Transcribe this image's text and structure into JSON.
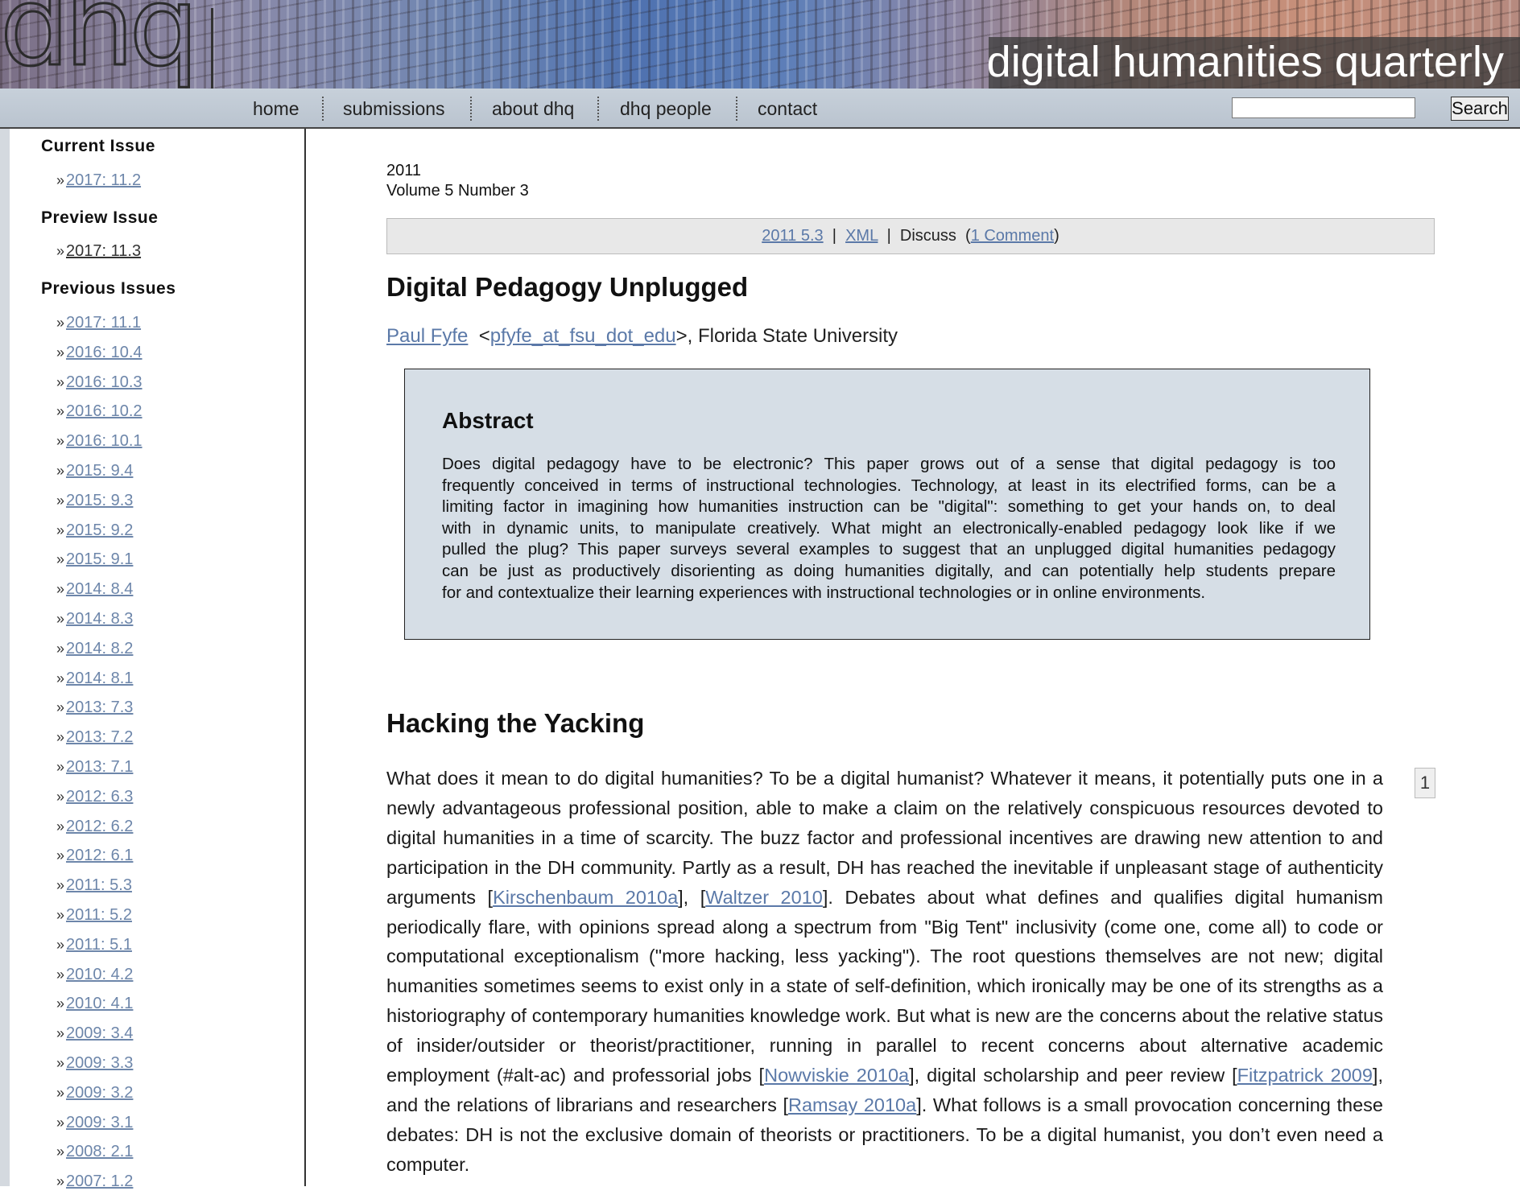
{
  "header": {
    "logo_text": "dhq",
    "site_title": "digital humanities quarterly"
  },
  "nav": {
    "items": [
      "home",
      "submissions",
      "about dhq",
      "dhq people",
      "contact"
    ],
    "search_button": "Search",
    "search_value": ""
  },
  "sidebar": {
    "current_heading": "Current Issue",
    "current": [
      "2017: 11.2"
    ],
    "preview_heading": "Preview Issue",
    "preview": [
      "2017: 11.3"
    ],
    "previous_heading": "Previous Issues",
    "previous": [
      "2017: 11.1",
      "2016: 10.4",
      "2016: 10.3",
      "2016: 10.2",
      "2016: 10.1",
      "2015: 9.4",
      "2015: 9.3",
      "2015: 9.2",
      "2015: 9.1",
      "2014: 8.4",
      "2014: 8.3",
      "2014: 8.2",
      "2014: 8.1",
      "2013: 7.3",
      "2013: 7.2",
      "2013: 7.1",
      "2012: 6.3",
      "2012: 6.2",
      "2012: 6.1",
      "2011: 5.3",
      "2011: 5.2",
      "2011: 5.1",
      "2010: 4.2",
      "2010: 4.1",
      "2009: 3.4",
      "2009: 3.3",
      "2009: 3.2",
      "2009: 3.1",
      "2008: 2.1",
      "2007: 1.2"
    ]
  },
  "issue": {
    "year": "2011",
    "volume": "Volume 5 Number 3",
    "issue_link": "2011 5.3",
    "xml_link": "XML",
    "discuss_label": "Discuss",
    "comments_link": "1 Comment"
  },
  "article": {
    "title": "Digital Pedagogy Unplugged",
    "author": "Paul Fyfe",
    "email": "pfyfe_at_fsu_dot_edu",
    "affiliation": "Florida State University",
    "abstract_heading": "Abstract",
    "abstract_lines": [
      "Does digital pedagogy have to be electronic? This paper grows out of a sense that digital pedagogy is too",
      "frequently conceived in terms of instructional technologies. Technology, at least in its electrified forms, can be a",
      "limiting factor in imagining how humanities instruction can be \"digital\": something to get your hands on, to deal",
      "with in dynamic units, to manipulate creatively. What might an electronically-enabled pedagogy look like if we",
      "pulled the plug? This paper surveys several examples to suggest that an unplugged digital humanities pedagogy",
      "can be just as productively disorienting as doing humanities digitally, and can potentially help students prepare",
      "for and contextualize their learning experiences with instructional technologies or in online environments."
    ],
    "section_heading": "Hacking the Yacking",
    "paragraph_number": "1",
    "paragraph": {
      "t1": "What does it mean to do digital humanities? To be a digital humanist? Whatever it means, it potentially puts one in a newly advantageous professional position, able to make a claim on the relatively conspicuous resources devoted to digital humanities in a time of scarcity. The buzz factor and professional incentives are drawing new attention to and participation in the DH community. Partly as a result, DH has reached the inevitable if unpleasant stage of authenticity arguments [",
      "c1": "Kirschenbaum 2010a",
      "t2": "], [",
      "c2": "Waltzer 2010",
      "t3": "]. Debates about what defines and qualifies digital humanism periodically flare, with opinions spread along a spectrum from \"Big Tent\" inclusivity (come one, come all) to code or computational exceptionalism (\"more hacking, less yacking\"). The root questions themselves are not new; digital humanities sometimes seems to exist only in a state of self-definition, which ironically may be one of its strengths as a historiography of contemporary humanities knowledge work. But what is new are the concerns about the relative status of insider/outsider or theorist/practitioner, running in parallel to recent concerns about alternative academic employment (#alt-ac) and professorial jobs [",
      "c3": "Nowviskie 2010a",
      "t4": "], digital scholarship and peer review [",
      "c4": "Fitzpatrick 2009",
      "t5": "], and the relations of librarians and researchers [",
      "c5": "Ramsay 2010a",
      "t6": "]. What follows is a small provocation concerning these debates: DH is not the exclusive domain of theorists or practitioners. To be a digital humanist, you don’t even need a computer."
    }
  },
  "colors": {
    "link": "#5b79a8",
    "nav_bg": "#c0c9d3",
    "abstract_bg": "#d6dee6",
    "issue_box_bg": "#e8e8e8"
  }
}
